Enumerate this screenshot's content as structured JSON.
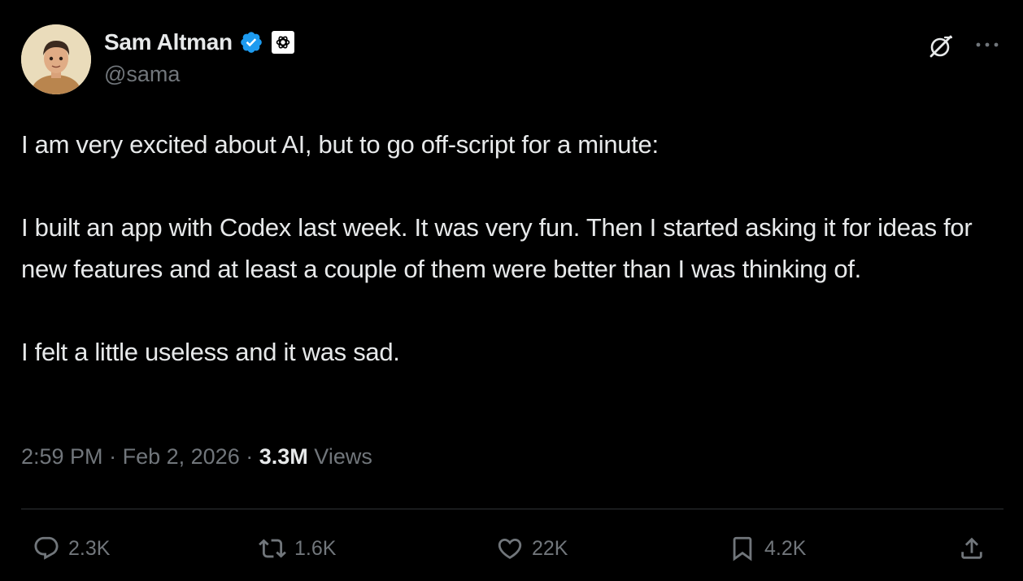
{
  "author": {
    "display_name": "Sam Altman",
    "handle": "@sama",
    "verified_icon": "verified-badge-icon",
    "affiliate_icon": "openai-logo-icon"
  },
  "header_actions": {
    "grok_icon": "grok-icon",
    "more_icon": "more-dots-icon"
  },
  "tweet": {
    "paragraphs": [
      "I am very excited about AI, but to go off-script for a minute:",
      "I built an app with Codex last week. It was very fun. Then I started asking it for ideas for new features and at least a couple of them were better than I was thinking of.",
      "I felt a little useless and it was sad."
    ],
    "time": "2:59 PM",
    "separator": "·",
    "date": "Feb 2, 2026",
    "views_count": "3.3M",
    "views_label": "Views"
  },
  "actions": {
    "replies": "2.3K",
    "reposts": "1.6K",
    "likes": "22K",
    "bookmarks": "4.2K"
  },
  "colors": {
    "background": "#000000",
    "text_primary": "#e7e9ea",
    "text_secondary": "#71767b",
    "verified_blue": "#1d9bf0",
    "divider": "#2f3336"
  }
}
